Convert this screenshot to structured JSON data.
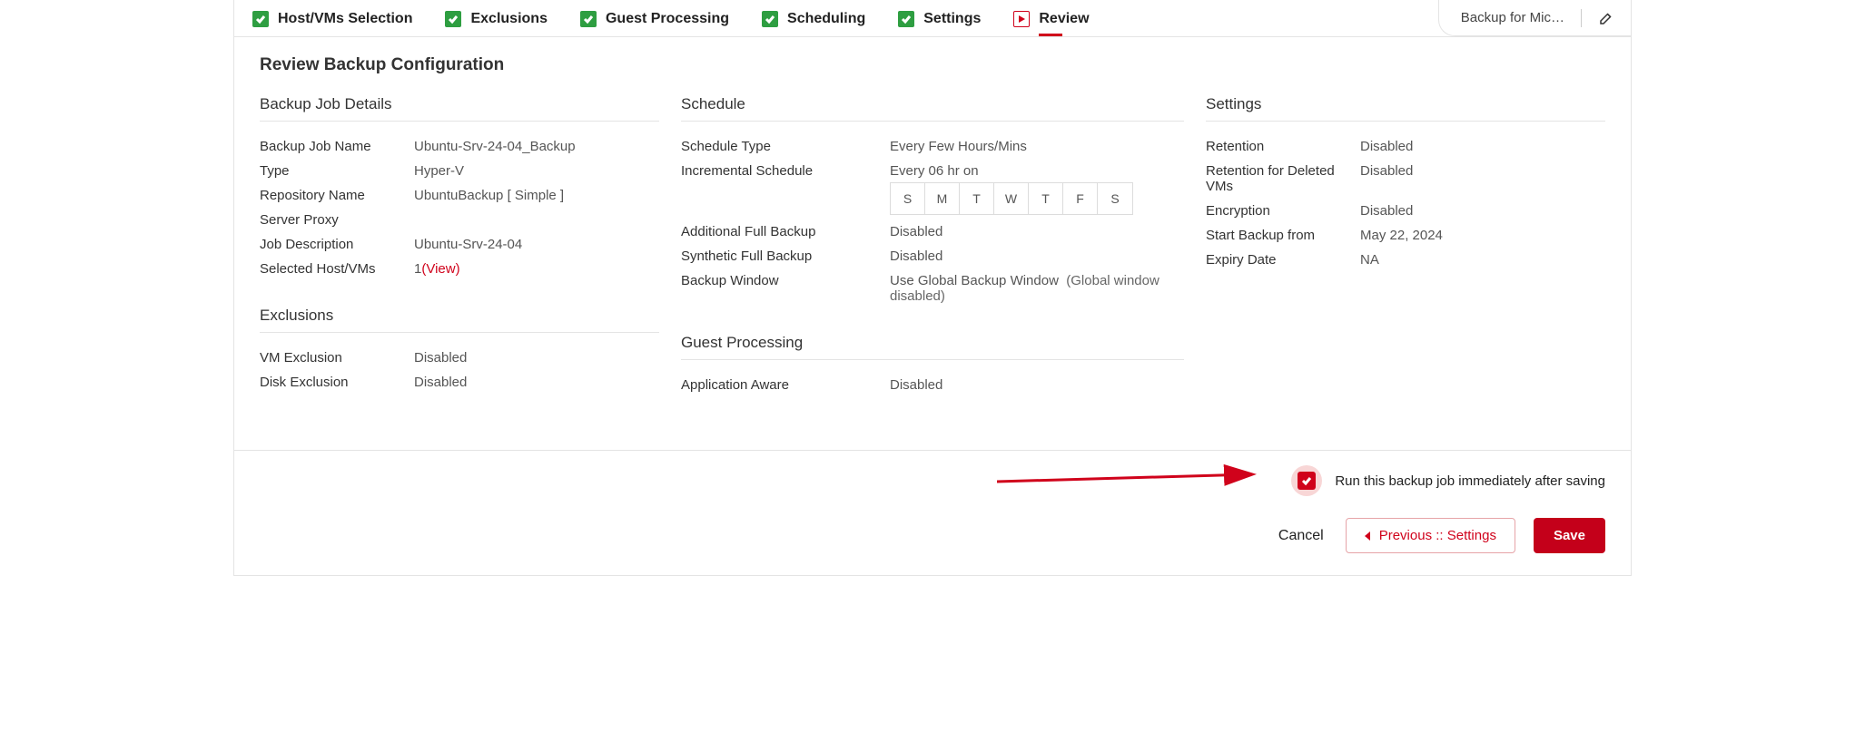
{
  "wizard_steps": [
    {
      "label": "Host/VMs Selection",
      "state": "done"
    },
    {
      "label": "Exclusions",
      "state": "done"
    },
    {
      "label": "Guest Processing",
      "state": "done"
    },
    {
      "label": "Scheduling",
      "state": "done"
    },
    {
      "label": "Settings",
      "state": "done"
    },
    {
      "label": "Review",
      "state": "active"
    }
  ],
  "top_right": {
    "title": "Backup for Mic…"
  },
  "page_title": "Review Backup Configuration",
  "backup_job_details": {
    "heading": "Backup Job Details",
    "rows": {
      "job_name_k": "Backup Job Name",
      "job_name_v": "Ubuntu-Srv-24-04_Backup",
      "type_k": "Type",
      "type_v": "Hyper-V",
      "repo_k": "Repository Name",
      "repo_v": "UbuntuBackup [ Simple ]",
      "proxy_k": "Server Proxy",
      "proxy_v": "",
      "desc_k": "Job Description",
      "desc_v": "Ubuntu-Srv-24-04",
      "selected_k": "Selected Host/VMs",
      "selected_count": "1",
      "selected_view": "(View)"
    }
  },
  "exclusions": {
    "heading": "Exclusions",
    "rows": {
      "vm_k": "VM Exclusion",
      "vm_v": "Disabled",
      "disk_k": "Disk Exclusion",
      "disk_v": "Disabled"
    }
  },
  "schedule": {
    "heading": "Schedule",
    "rows": {
      "type_k": "Schedule Type",
      "type_v": "Every Few Hours/Mins",
      "incr_k": "Incremental Schedule",
      "incr_v": "Every 06 hr on",
      "days": [
        "S",
        "M",
        "T",
        "W",
        "T",
        "F",
        "S"
      ],
      "addfull_k": "Additional Full Backup",
      "addfull_v": "Disabled",
      "synth_k": "Synthetic Full Backup",
      "synth_v": "Disabled",
      "window_k": "Backup Window",
      "window_v": "Use Global Backup Window",
      "window_note": "(Global window disabled)"
    }
  },
  "guest": {
    "heading": "Guest Processing",
    "rows": {
      "app_k": "Application Aware",
      "app_v": "Disabled"
    }
  },
  "settings": {
    "heading": "Settings",
    "rows": {
      "ret_k": "Retention",
      "ret_v": "Disabled",
      "retdel_k": "Retention for Deleted VMs",
      "retdel_v": "Disabled",
      "enc_k": "Encryption",
      "enc_v": "Disabled",
      "start_k": "Start Backup from",
      "start_v": "May 22, 2024",
      "exp_k": "Expiry Date",
      "exp_v": "NA"
    }
  },
  "footer": {
    "run_label": "Run this backup job immediately after saving",
    "cancel": "Cancel",
    "previous": "Previous :: Settings",
    "save": "Save"
  }
}
